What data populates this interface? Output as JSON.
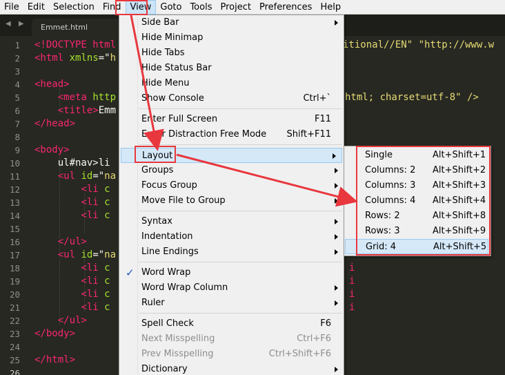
{
  "menubar": {
    "items": [
      {
        "label": "File",
        "name": "menu-file"
      },
      {
        "label": "Edit",
        "name": "menu-edit"
      },
      {
        "label": "Selection",
        "name": "menu-selection"
      },
      {
        "label": "Find",
        "name": "menu-find"
      },
      {
        "label": "View",
        "name": "menu-view"
      },
      {
        "label": "Goto",
        "name": "menu-goto"
      },
      {
        "label": "Tools",
        "name": "menu-tools"
      },
      {
        "label": "Project",
        "name": "menu-project"
      },
      {
        "label": "Preferences",
        "name": "menu-preferences"
      },
      {
        "label": "Help",
        "name": "menu-help"
      }
    ]
  },
  "tabs": {
    "nav_glyph": "◀ ▶",
    "active_tab": "Emmet.html"
  },
  "editor": {
    "line_numbers": [
      "1",
      "2",
      "3",
      "4",
      "5",
      "6",
      "7",
      "8",
      "9",
      "10",
      "11",
      "12",
      "13",
      "14",
      "15",
      "16",
      "17",
      "18",
      "19",
      "20",
      "21",
      "22",
      "23",
      "24",
      "25",
      "26"
    ],
    "right_fragments": {
      "line1": "itional//EN\" \"http://www.w",
      "line5": "html; charset=utf-8\" />",
      "line17": "i",
      "line18": "i",
      "line19": "i",
      "line20": "i"
    }
  },
  "view_menu": {
    "items": [
      {
        "label": "Side Bar",
        "shortcut": "",
        "submenu": true
      },
      {
        "label": "Hide Minimap",
        "shortcut": ""
      },
      {
        "label": "Hide Tabs",
        "shortcut": ""
      },
      {
        "label": "Hide Status Bar",
        "shortcut": ""
      },
      {
        "label": "Hide Menu",
        "shortcut": ""
      },
      {
        "label": "Show Console",
        "shortcut": "Ctrl+`"
      },
      {
        "label": "Enter Full Screen",
        "shortcut": "F11"
      },
      {
        "label": "Enter Distraction Free Mode",
        "shortcut": "Shift+F11"
      },
      {
        "label": "Layout",
        "shortcut": "",
        "submenu": true
      },
      {
        "label": "Groups",
        "shortcut": "",
        "submenu": true
      },
      {
        "label": "Focus Group",
        "shortcut": "",
        "submenu": true
      },
      {
        "label": "Move File to Group",
        "shortcut": "",
        "submenu": true
      },
      {
        "label": "Syntax",
        "shortcut": "",
        "submenu": true
      },
      {
        "label": "Indentation",
        "shortcut": "",
        "submenu": true
      },
      {
        "label": "Line Endings",
        "shortcut": "",
        "submenu": true
      },
      {
        "label": "Word Wrap",
        "shortcut": "",
        "checked": true
      },
      {
        "label": "Word Wrap Column",
        "shortcut": "",
        "submenu": true
      },
      {
        "label": "Ruler",
        "shortcut": "",
        "submenu": true
      },
      {
        "label": "Spell Check",
        "shortcut": "F6"
      },
      {
        "label": "Next Misspelling",
        "shortcut": "Ctrl+F6",
        "disabled": true
      },
      {
        "label": "Prev Misspelling",
        "shortcut": "Ctrl+Shift+F6",
        "disabled": true
      },
      {
        "label": "Dictionary",
        "shortcut": "",
        "submenu": true
      }
    ],
    "check_glyph": "✓"
  },
  "layout_menu": {
    "items": [
      {
        "label": "Single",
        "shortcut": "Alt+Shift+1"
      },
      {
        "label": "Columns: 2",
        "shortcut": "Alt+Shift+2"
      },
      {
        "label": "Columns: 3",
        "shortcut": "Alt+Shift+3"
      },
      {
        "label": "Columns: 4",
        "shortcut": "Alt+Shift+4"
      },
      {
        "label": "Rows: 2",
        "shortcut": "Alt+Shift+8"
      },
      {
        "label": "Rows: 3",
        "shortcut": "Alt+Shift+9"
      },
      {
        "label": "Grid: 4",
        "shortcut": "Alt+Shift+5"
      }
    ]
  },
  "colors": {
    "editor_bg": "#272822",
    "tag": "#f92672",
    "attribute": "#a6e22e",
    "string": "#e6db74",
    "annotation_red": "#e8373d",
    "menu_highlight": "#d5e8f8"
  }
}
